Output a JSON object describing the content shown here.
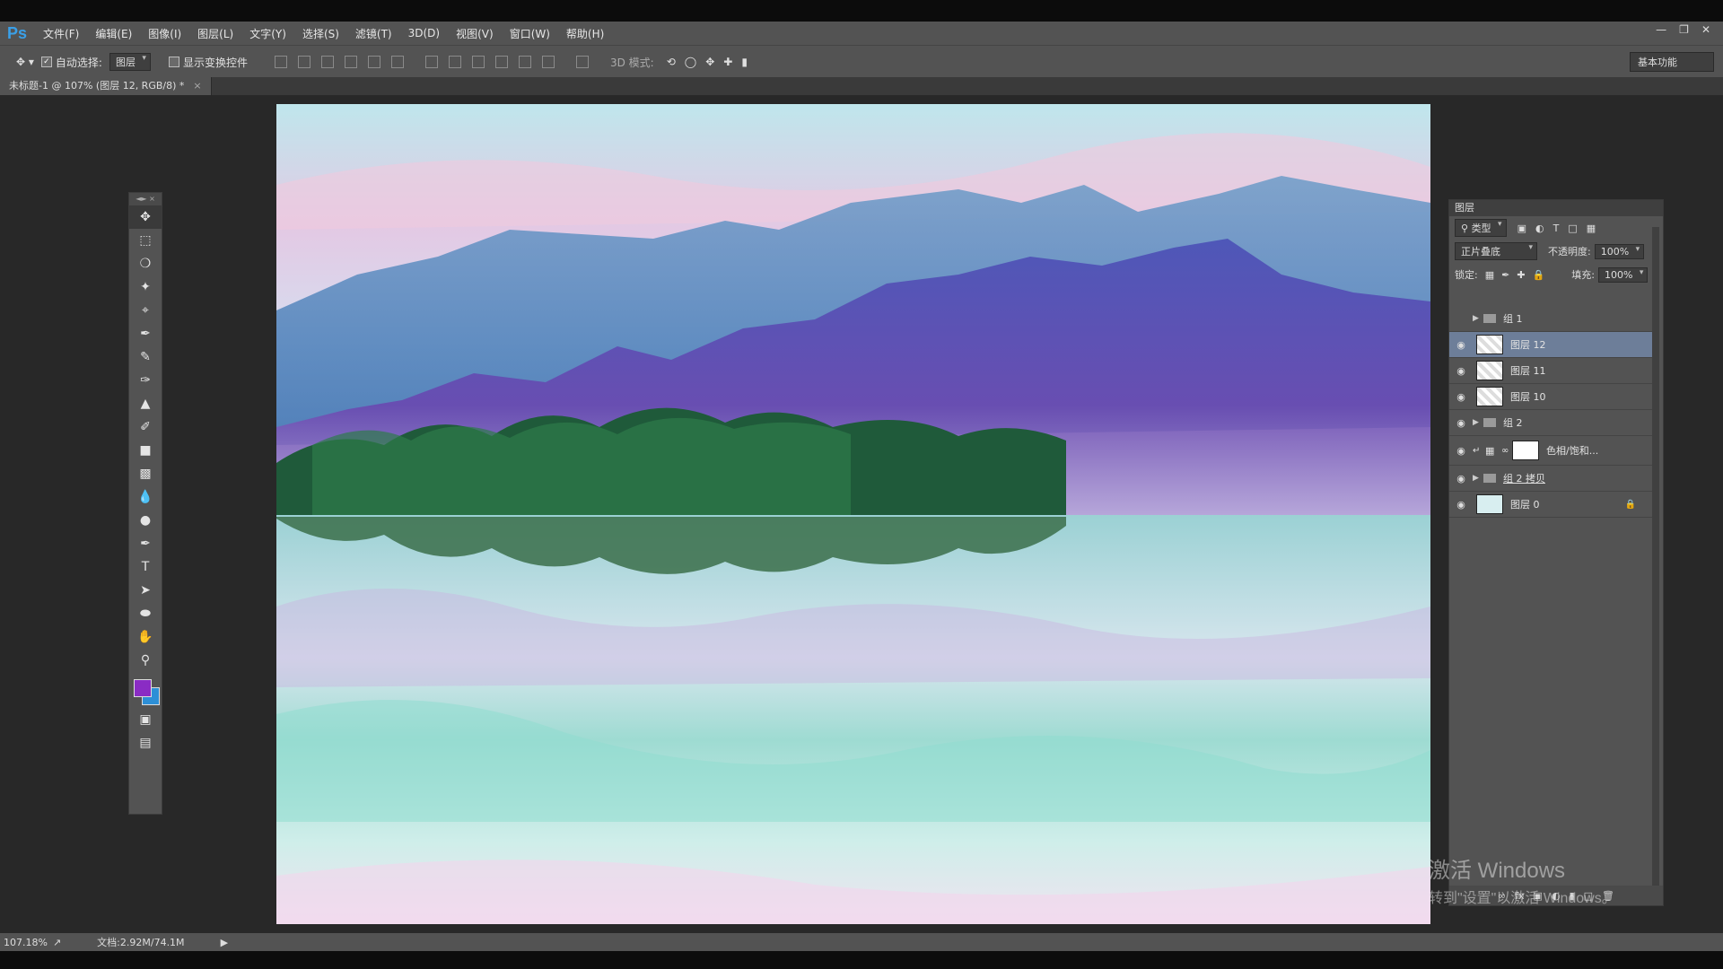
{
  "app": {
    "logo": "Ps"
  },
  "menu": [
    "文件(F)",
    "编辑(E)",
    "图像(I)",
    "图层(L)",
    "文字(Y)",
    "选择(S)",
    "滤镜(T)",
    "3D(D)",
    "视图(V)",
    "窗口(W)",
    "帮助(H)"
  ],
  "options": {
    "auto_select_label": "自动选择:",
    "auto_select_value": "图层",
    "show_transform_label": "显示变换控件",
    "mode3d_label": "3D 模式:",
    "workspace": "基本功能"
  },
  "document": {
    "tab_title": "未标题-1 @ 107% (图层 12, RGB/8) *"
  },
  "layers_panel": {
    "title": "图层",
    "filter": "类型",
    "blend_mode": "正片叠底",
    "opacity_label": "不透明度:",
    "opacity_value": "100%",
    "lock_label": "锁定:",
    "fill_label": "填充:",
    "fill_value": "100%",
    "layers": [
      {
        "name": "组 1",
        "type": "group"
      },
      {
        "name": "图层 12",
        "type": "layer",
        "selected": true
      },
      {
        "name": "图层 11",
        "type": "layer"
      },
      {
        "name": "图层 10",
        "type": "layer"
      },
      {
        "name": "组 2",
        "type": "group"
      },
      {
        "name": "色相/饱和...",
        "type": "adjustment"
      },
      {
        "name": "组 2 拷贝",
        "type": "group"
      },
      {
        "name": "图层 0",
        "type": "layer",
        "locked": true
      }
    ]
  },
  "status": {
    "zoom": "107.18%",
    "doc_size": "文档:2.92M/74.1M"
  },
  "watermark": {
    "line1": "激活 Windows",
    "line2": "转到\"设置\"以激活 Windows。"
  },
  "colors": {
    "foreground": "#8a2cc4",
    "background": "#2d8fd6",
    "selection": "#6d7e99"
  }
}
